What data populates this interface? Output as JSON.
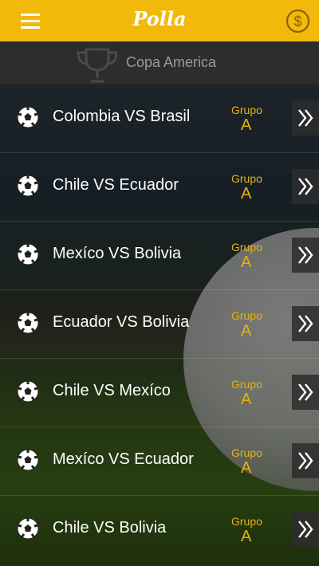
{
  "header": {
    "title": "Polla"
  },
  "subheader": {
    "title": "Copa America"
  },
  "matches": [
    {
      "name": "Colombia VS Brasil",
      "group_label": "Grupo",
      "group": "A"
    },
    {
      "name": "Chile VS Ecuador",
      "group_label": "Grupo",
      "group": "A"
    },
    {
      "name": "Mexíco VS Bolivia",
      "group_label": "Grupo",
      "group": "A"
    },
    {
      "name": "Ecuador VS Bolivia",
      "group_label": "Grupo",
      "group": "A"
    },
    {
      "name": "Chile VS Mexíco",
      "group_label": "Grupo",
      "group": "A"
    },
    {
      "name": "Mexíco VS Ecuador",
      "group_label": "Grupo",
      "group": "A"
    },
    {
      "name": "Chile VS Bolivia",
      "group_label": "Grupo",
      "group": "A"
    }
  ],
  "colors": {
    "brand": "#f2b90b",
    "accent_text": "#e8b20f",
    "subheader_bg": "#2d2d2d"
  },
  "icons": {
    "menu": "hamburger-menu-icon",
    "coin": "dollar-coin-icon",
    "trophy": "trophy-icon",
    "ball": "soccer-ball-icon",
    "arrow": "double-chevron-right-icon"
  }
}
